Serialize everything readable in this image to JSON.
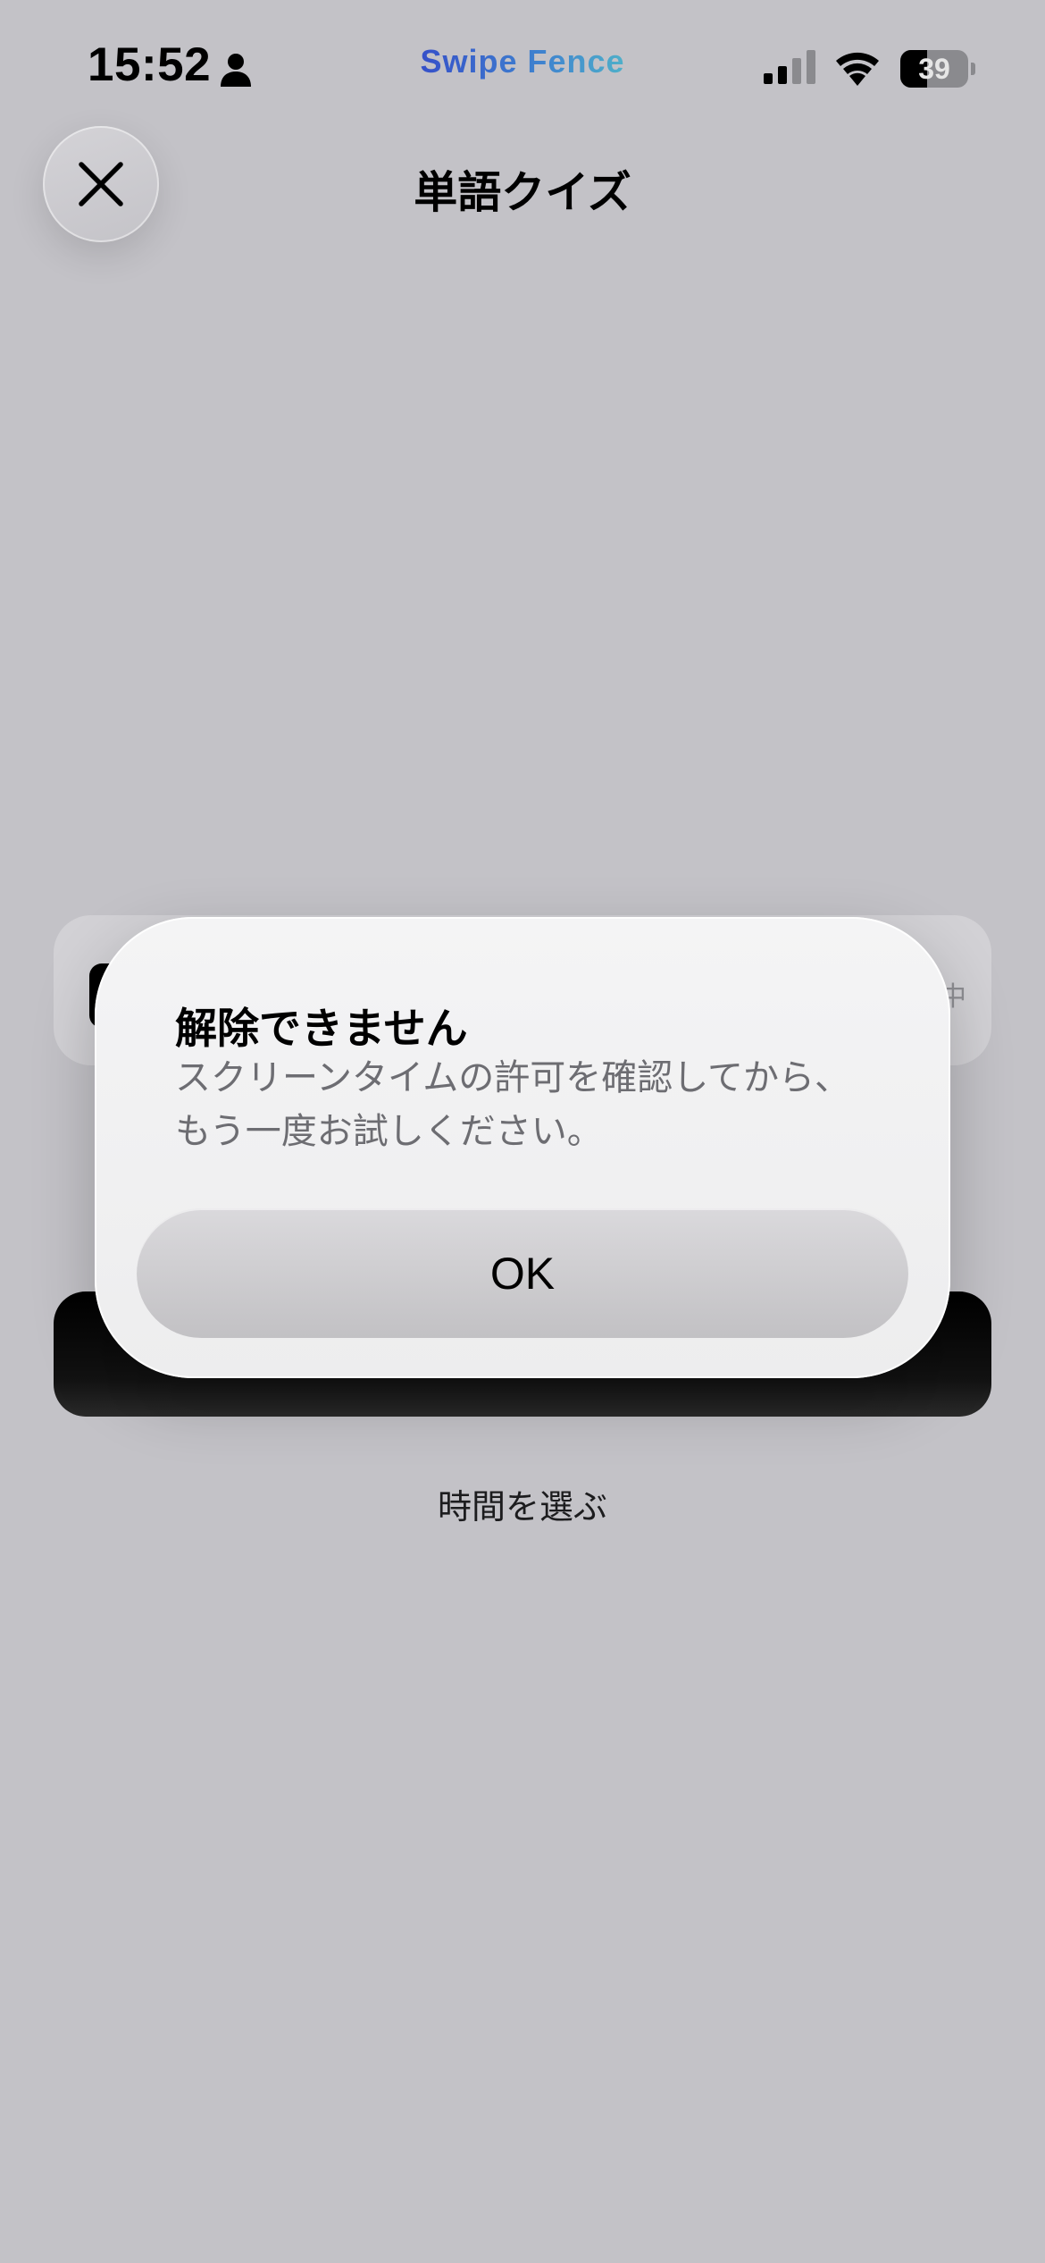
{
  "status_bar": {
    "time": "15:52",
    "app_brand": "Swipe Fence",
    "battery_level": "39",
    "battery_fraction": 0.39,
    "person_icon": "person-icon",
    "signal_icon": "cellular-signal-icon",
    "wifi_icon": "wifi-icon"
  },
  "header": {
    "title": "単語クイズ",
    "close_icon": "close-icon"
  },
  "background": {
    "status_card_tail": "中",
    "choose_time": "時間を選ぶ"
  },
  "alert": {
    "title": "解除できません",
    "message_line1": "スクリーンタイムの許可を確認してから、",
    "message_line2": "もう一度お試しください。",
    "ok_label": "OK"
  },
  "colors": {
    "background": "#c3c2c7",
    "brand_gradient_start": "#3550c9",
    "brand_gradient_end": "#4fb0c9",
    "alert_surface": "#f4f4f5",
    "message_text": "#6d6d72"
  }
}
